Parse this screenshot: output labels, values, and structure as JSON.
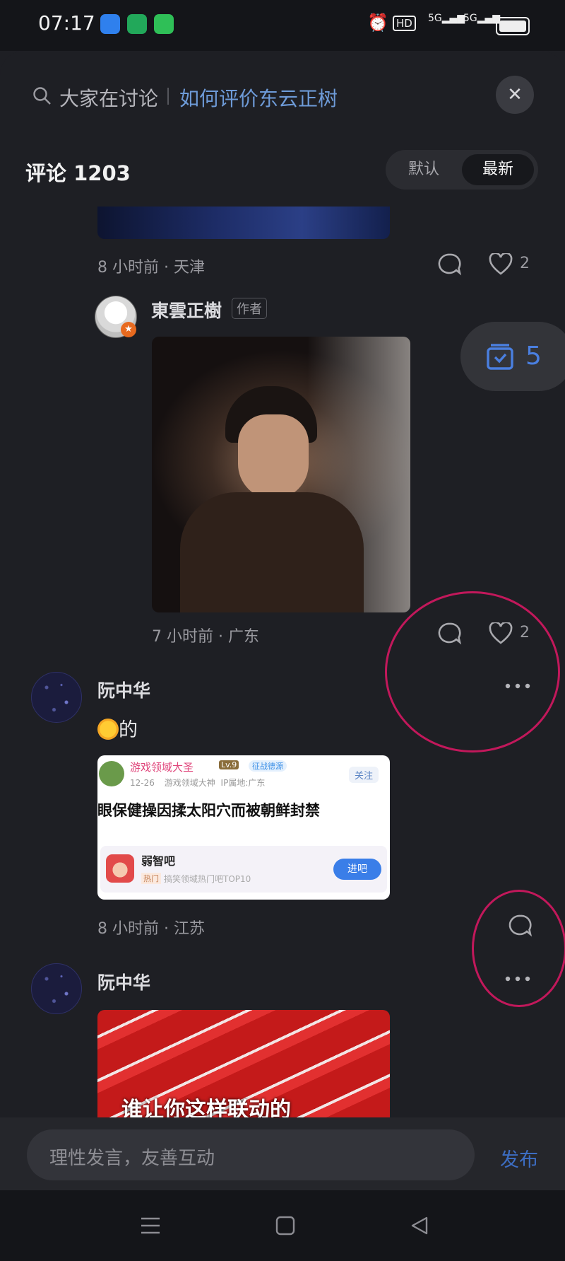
{
  "status_bar": {
    "time": "07:17",
    "hd_label": "HD",
    "net1": "5G",
    "net2": "5G"
  },
  "search": {
    "label": "大家在讨论",
    "topic": "如何评价东云正树"
  },
  "comments_header": {
    "title": "评论 1203",
    "sort_default": "默认",
    "sort_latest": "最新"
  },
  "comments": [
    {
      "time": "8 小时前",
      "region": "天津",
      "likes": "2"
    },
    {
      "user": "東雲正樹",
      "tag": "作者",
      "time": "7 小时前",
      "region": "广东",
      "likes": "2"
    },
    {
      "user": "阮中华",
      "text": "的",
      "time": "8 小时前",
      "region": "江苏",
      "card": {
        "user": "游戏领域大圣",
        "level": "Lv.9",
        "badge": "征战德源",
        "date": "12-26",
        "role": "游戏领域大神",
        "ip": "IP属地:广东",
        "follow": "关注",
        "headline": "眼保健操因揉太阳穴而被朝鲜封禁",
        "bar_name": "弱智吧",
        "bar_tag": "热门",
        "bar_desc": "搞笑领域热门吧TOP10",
        "enter": "进吧"
      }
    },
    {
      "user": "阮中华",
      "image_caption": "谁让你这样联动的"
    }
  ],
  "floating_badge": {
    "count": "5"
  },
  "composer": {
    "placeholder": "理性发言，友善互动",
    "publish": "发布"
  },
  "colors": {
    "accent": "#3d6ec4",
    "topic": "#6e9bd8",
    "highlight": "#c2185b"
  }
}
